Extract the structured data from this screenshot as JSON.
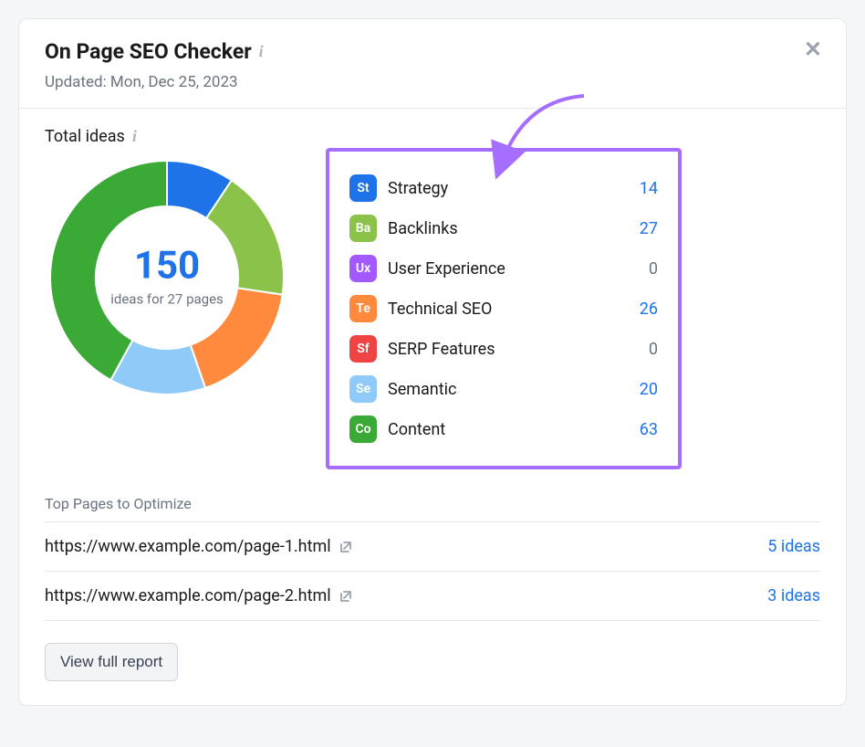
{
  "header": {
    "title": "On Page SEO Checker",
    "updated": "Updated: Mon, Dec 25, 2023"
  },
  "total_ideas": {
    "label": "Total ideas",
    "number": "150",
    "sub": "ideas for 27 pages"
  },
  "categories": [
    {
      "code": "St",
      "label": "Strategy",
      "value": "14",
      "color": "#1e73e8",
      "zero": false
    },
    {
      "code": "Ba",
      "label": "Backlinks",
      "value": "27",
      "color": "#8bc34a",
      "zero": false
    },
    {
      "code": "Ux",
      "label": "User Experience",
      "value": "0",
      "color": "#a259ff",
      "zero": true
    },
    {
      "code": "Te",
      "label": "Technical SEO",
      "value": "26",
      "color": "#ff8a3d",
      "zero": false
    },
    {
      "code": "Sf",
      "label": "SERP Features",
      "value": "0",
      "color": "#ef4444",
      "zero": true
    },
    {
      "code": "Se",
      "label": "Semantic",
      "value": "20",
      "color": "#90caf9",
      "zero": false
    },
    {
      "code": "Co",
      "label": "Content",
      "value": "63",
      "color": "#3ba935",
      "zero": false
    }
  ],
  "top_pages": {
    "title": "Top Pages to Optimize",
    "rows": [
      {
        "url": "https://www.example.com/page-1.html",
        "ideas": "5 ideas"
      },
      {
        "url": "https://www.example.com/page-2.html",
        "ideas": "3 ideas"
      }
    ]
  },
  "button": {
    "label": "View full report"
  },
  "chart_data": {
    "type": "pie",
    "title": "Total ideas",
    "categories": [
      "Strategy",
      "Backlinks",
      "User Experience",
      "Technical SEO",
      "SERP Features",
      "Semantic",
      "Content"
    ],
    "values": [
      14,
      27,
      0,
      26,
      0,
      20,
      63
    ],
    "colors": [
      "#1e73e8",
      "#8bc34a",
      "#a259ff",
      "#ff8a3d",
      "#ef4444",
      "#90caf9",
      "#3ba935"
    ],
    "total": 150
  }
}
